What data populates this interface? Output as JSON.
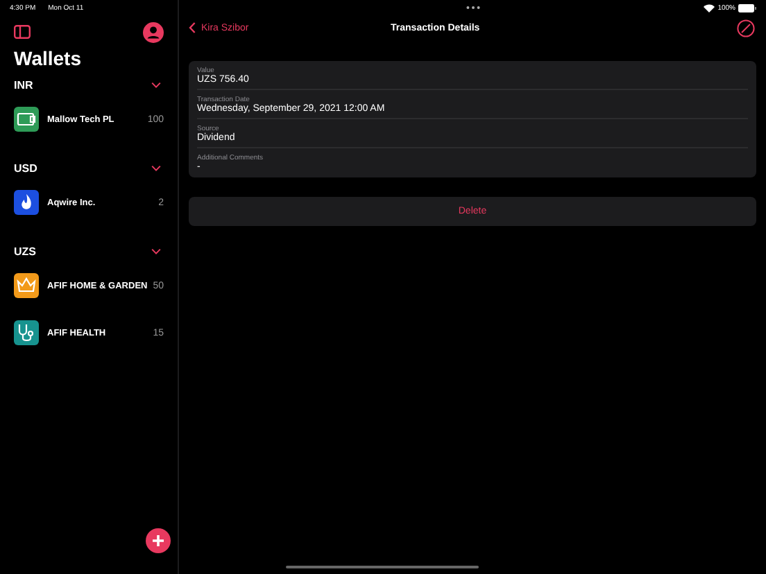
{
  "status_bar": {
    "time": "4:30 PM",
    "date": "Mon Oct 11",
    "battery": "100%"
  },
  "sidebar": {
    "title": "Wallets",
    "groups": [
      {
        "currency": "INR",
        "expanded": true,
        "wallets": [
          {
            "name": "Mallow Tech PL",
            "count": "100",
            "kind": "cash",
            "color": "#2e9b57"
          }
        ]
      },
      {
        "currency": "USD",
        "expanded": true,
        "wallets": [
          {
            "name": "Aqwire Inc.",
            "count": "2",
            "kind": "flame",
            "color": "#1c4fe0"
          }
        ]
      },
      {
        "currency": "UZS",
        "expanded": true,
        "wallets": [
          {
            "name": "AFIF HOME & GARDEN",
            "count": "50",
            "kind": "crown",
            "color": "#f29a1a"
          },
          {
            "name": "AFIF HEALTH",
            "count": "15",
            "kind": "stethoscope",
            "color": "#17938f"
          }
        ]
      }
    ]
  },
  "detail": {
    "back_label": "Kira Szibor",
    "title": "Transaction Details",
    "fields": [
      {
        "label": "Value",
        "value": "UZS 756.40"
      },
      {
        "label": "Transaction Date",
        "value": "Wednesday, September 29, 2021 12:00 AM"
      },
      {
        "label": "Source",
        "value": "Dividend"
      },
      {
        "label": "Additional Comments",
        "value": "-"
      }
    ],
    "delete_label": "Delete"
  }
}
